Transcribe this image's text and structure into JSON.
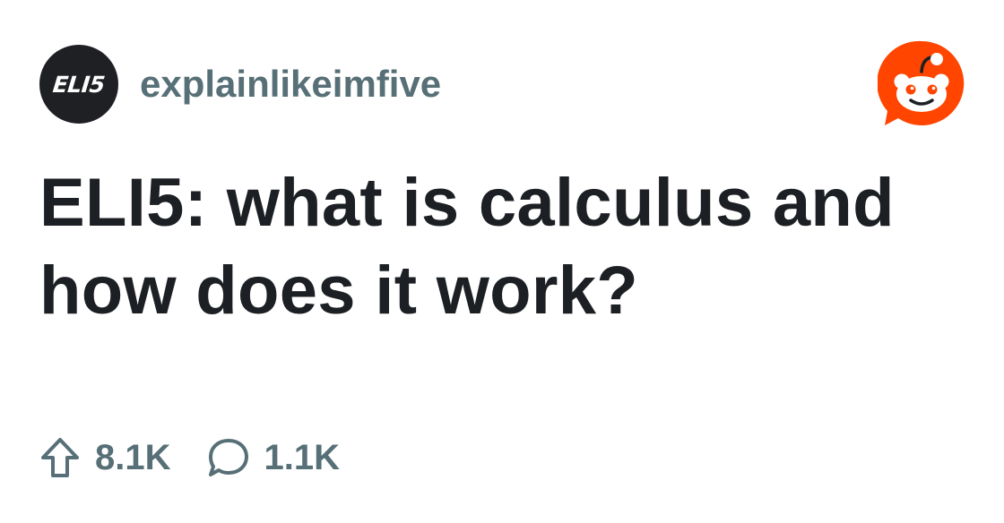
{
  "community": {
    "avatar_text": "ELI5",
    "name": "explainlikeimfive",
    "avatar_bg": "#1f2023"
  },
  "brand": {
    "logo_icon": "reddit-snoo-icon",
    "color": "#ff4500"
  },
  "post": {
    "title": "ELI5: what is calculus and how does it work?"
  },
  "stats": {
    "upvote_icon": "upvote-arrow-icon",
    "upvotes": "8.1K",
    "comment_icon": "comment-bubble-icon",
    "comments": "1.1K"
  },
  "colors": {
    "title_text": "#1c1f23",
    "muted_text": "#576f76"
  }
}
